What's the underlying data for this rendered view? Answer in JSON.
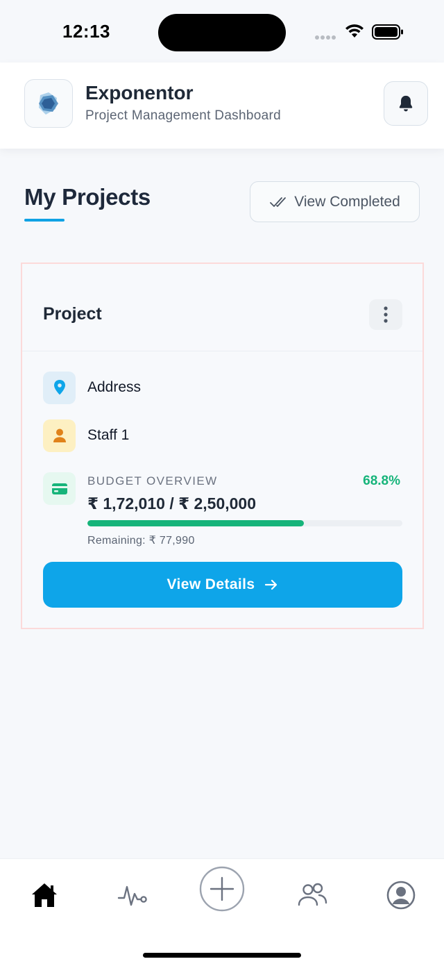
{
  "status_bar": {
    "time": "12:13"
  },
  "header": {
    "app_name": "Exponentor",
    "subtitle": "Project Management Dashboard",
    "logo_icon": "hexagon-logo-icon",
    "notification_icon": "bell-icon"
  },
  "section": {
    "title": "My Projects",
    "view_completed_label": "View Completed",
    "view_completed_icon": "double-check-icon"
  },
  "project_card": {
    "name": "Project",
    "address_label": "Address",
    "staff_label": "Staff 1",
    "budget": {
      "caption": "BUDGET OVERVIEW",
      "percent_text": "68.8%",
      "percent_value": 68.8,
      "amount_text": "₹ 1,72,010 / ₹ 2,50,000",
      "spent": 172010,
      "total": 250000,
      "remaining_text": "Remaining: ₹ 77,990"
    },
    "view_details_label": "View Details"
  },
  "tab_bar": {
    "tabs": [
      {
        "icon": "home-icon",
        "active": true
      },
      {
        "icon": "activity-icon",
        "active": false
      },
      {
        "icon": "add-icon",
        "active": false
      },
      {
        "icon": "team-icon",
        "active": false
      },
      {
        "icon": "profile-icon",
        "active": false
      }
    ]
  },
  "colors": {
    "accent": "#0ea5e9",
    "success": "#16b47a",
    "card_border": "#fcdada",
    "location_tile": "#e0eef8",
    "staff_tile": "#fdf0c2",
    "budget_tile": "#e6f8f0"
  }
}
